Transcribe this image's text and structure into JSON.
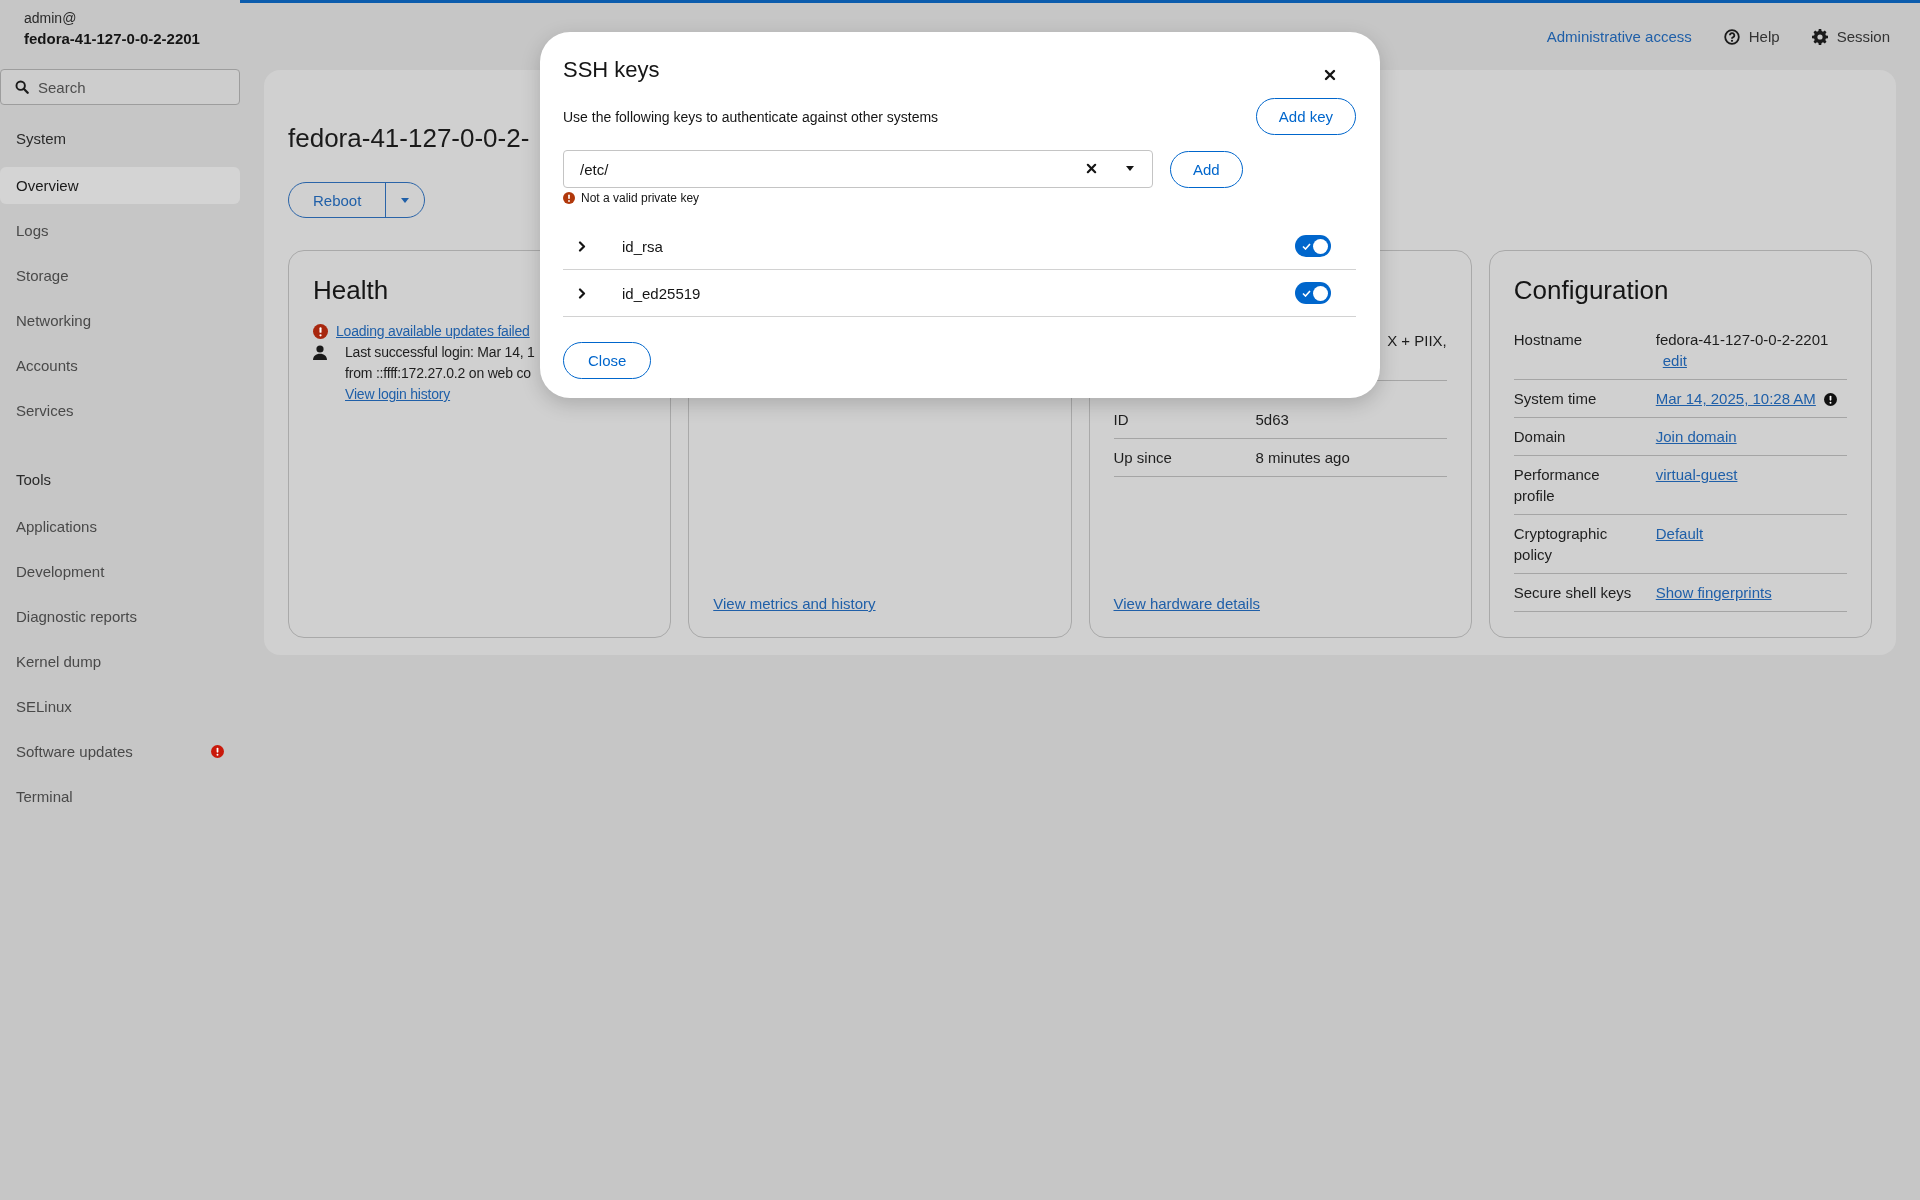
{
  "sidebar": {
    "user": "admin@",
    "host": "fedora-41-127-0-0-2-2201",
    "search": {
      "placeholder": "Search"
    },
    "sections": [
      {
        "heading": "System",
        "items": [
          {
            "label": "Overview",
            "selected": true,
            "alert": false
          },
          {
            "label": "Logs",
            "selected": false,
            "alert": false
          },
          {
            "label": "Storage",
            "selected": false,
            "alert": false
          },
          {
            "label": "Networking",
            "selected": false,
            "alert": false
          },
          {
            "label": "Accounts",
            "selected": false,
            "alert": false
          },
          {
            "label": "Services",
            "selected": false,
            "alert": false
          }
        ]
      },
      {
        "heading": "Tools",
        "items": [
          {
            "label": "Applications",
            "selected": false,
            "alert": false
          },
          {
            "label": "Development",
            "selected": false,
            "alert": false
          },
          {
            "label": "Diagnostic reports",
            "selected": false,
            "alert": false
          },
          {
            "label": "Kernel dump",
            "selected": false,
            "alert": false
          },
          {
            "label": "SELinux",
            "selected": false,
            "alert": false
          },
          {
            "label": "Software updates",
            "selected": false,
            "alert": true
          },
          {
            "label": "Terminal",
            "selected": false,
            "alert": false
          }
        ]
      }
    ]
  },
  "topbar": {
    "admin_access": "Administrative access",
    "help": "Help",
    "session": "Session"
  },
  "page": {
    "title": "fedora-41-127-0-0-2-",
    "reboot_button": "Reboot"
  },
  "cards": [
    {
      "kind": "health",
      "title": "Health",
      "items": [
        {
          "kind": "error",
          "link": "Loading available updates failed"
        },
        {
          "kind": "login",
          "lines": [
            "Last successful login: Mar 14, 1",
            "from ::ffff:172.27.0.2 on web co"
          ],
          "link": "View login history"
        }
      ]
    },
    {
      "kind": "usage",
      "link": "View metrics and history"
    },
    {
      "kind": "system",
      "rows": [
        {
          "kind": "tail",
          "value": "X + PIIX,"
        },
        {
          "kind": "cut",
          "label": "ID",
          "value": "5d63"
        },
        {
          "kind": "plain",
          "label": "Up since",
          "value": "8 minutes ago"
        }
      ],
      "link": "View hardware details"
    },
    {
      "kind": "config",
      "title": "Configuration",
      "rows": [
        {
          "label": "Hostname",
          "value": "fedora-41-127-0-0-2-2201",
          "link": "edit",
          "warning": false
        },
        {
          "label": "System time",
          "link": "Mar 14, 2025, 10:28 AM",
          "warning": true
        },
        {
          "label": "Domain",
          "link": "Join domain",
          "warning": false
        },
        {
          "label": "Performance profile",
          "link": "virtual-guest",
          "warning": false
        },
        {
          "label": "Cryptographic policy",
          "link": "Default",
          "warning": false
        },
        {
          "label": "Secure shell keys",
          "link": "Show fingerprints",
          "warning": false
        }
      ]
    }
  ],
  "modal": {
    "title": "SSH keys",
    "description": "Use the following keys to authenticate against other systems",
    "add_key": "Add key",
    "path_field": {
      "value": "/etc/"
    },
    "add": "Add",
    "error": "Not a valid private key",
    "keys": [
      {
        "name": "id_rsa",
        "expanded": false,
        "on": true
      },
      {
        "name": "id_ed25519",
        "expanded": false,
        "on": true
      }
    ],
    "close": "Close"
  }
}
